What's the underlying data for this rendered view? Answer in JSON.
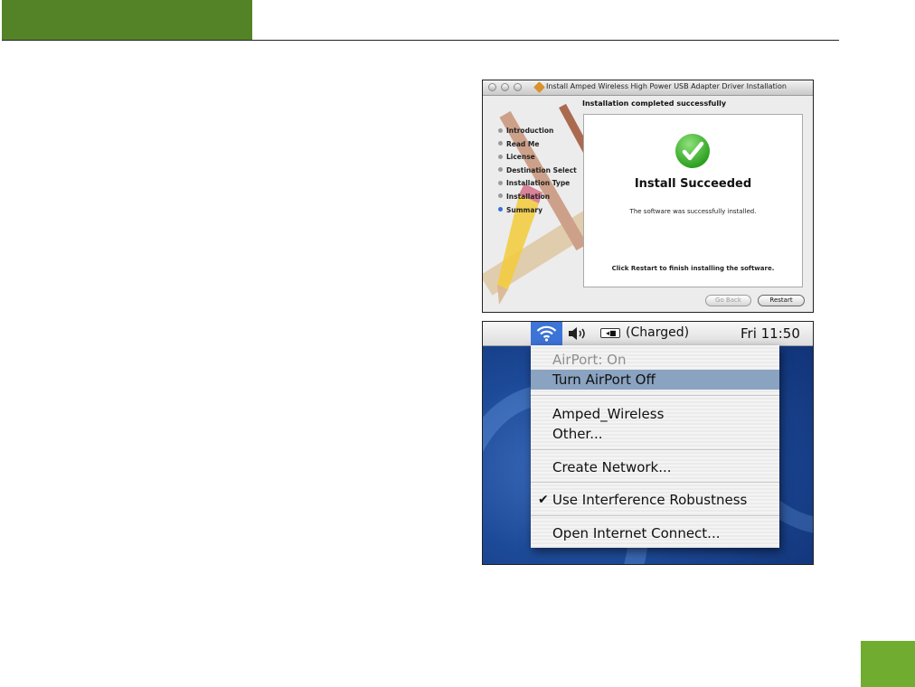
{
  "installer": {
    "window_title": "Install Amped Wireless High Power USB Adapter Driver Installation",
    "step_heading": "Installation completed successfully",
    "steps": [
      {
        "label": "Introduction"
      },
      {
        "label": "Read Me"
      },
      {
        "label": "License"
      },
      {
        "label": "Destination Select"
      },
      {
        "label": "Installation Type"
      },
      {
        "label": "Installation"
      },
      {
        "label": "Summary"
      }
    ],
    "active_step": "Summary",
    "success_title": "Install Succeeded",
    "success_message": "The software was successfully installed.",
    "restart_hint": "Click Restart to finish installing the software.",
    "back_button": "Go Back",
    "restart_button": "Restart"
  },
  "airport": {
    "battery_label": "(Charged)",
    "clock": "Fri 11:50",
    "menu": {
      "status": "AirPort: On",
      "toggle": "Turn AirPort Off",
      "network": "Amped_Wireless",
      "other": "Other...",
      "create": "Create Network...",
      "robustness": "Use Interference Robustness",
      "robustness_checked": true,
      "open_connect": "Open Internet Connect..."
    }
  },
  "colors": {
    "header_green": "#548327",
    "page_badge_green": "#6fac2f",
    "menu_highlight": "#8aa3c1",
    "wifi_active": "#3d74d8"
  }
}
